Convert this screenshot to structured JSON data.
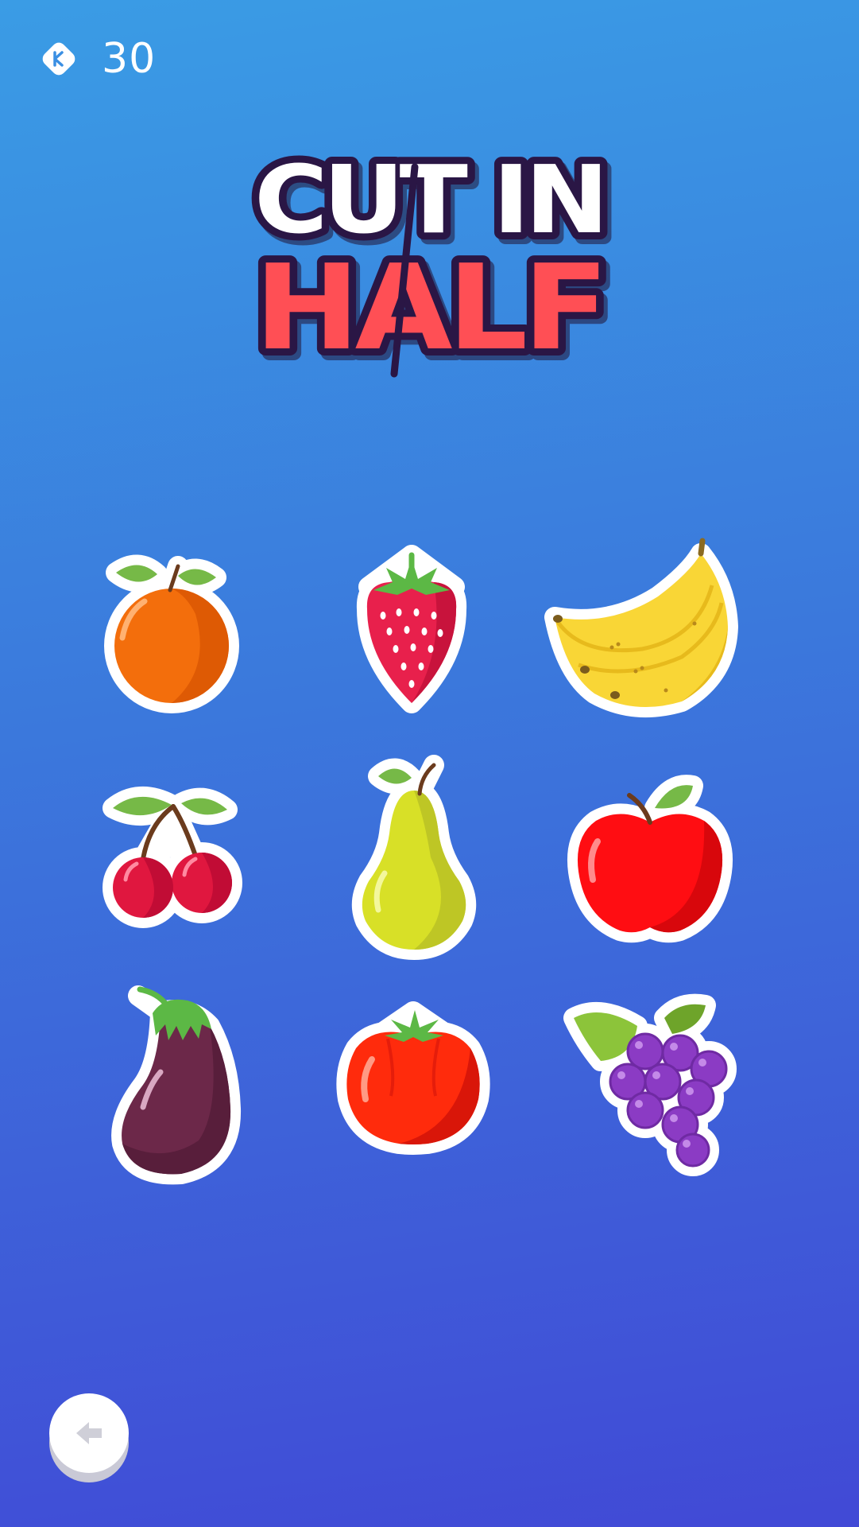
{
  "hud": {
    "coin_icon": "diamond-coin-icon",
    "coin_count": "30"
  },
  "title": {
    "line1": "CUT IN",
    "line2": "HALF",
    "line1_color": "#ffffff",
    "line2_color": "#ff4f55",
    "outline_color": "#2a1645"
  },
  "level_tiles": [
    {
      "icon": "orange-icon"
    },
    {
      "icon": "strawberry-icon"
    },
    {
      "icon": "banana-icon"
    },
    {
      "icon": "cherries-icon"
    },
    {
      "icon": "pear-icon"
    },
    {
      "icon": "apple-icon"
    },
    {
      "icon": "eggplant-icon"
    },
    {
      "icon": "tomato-icon"
    },
    {
      "icon": "grapes-icon"
    }
  ],
  "footer": {
    "back_icon": "back-arrow-icon"
  },
  "colors": {
    "background_top": "#3a9ce5",
    "background_bottom": "#4149d6"
  }
}
